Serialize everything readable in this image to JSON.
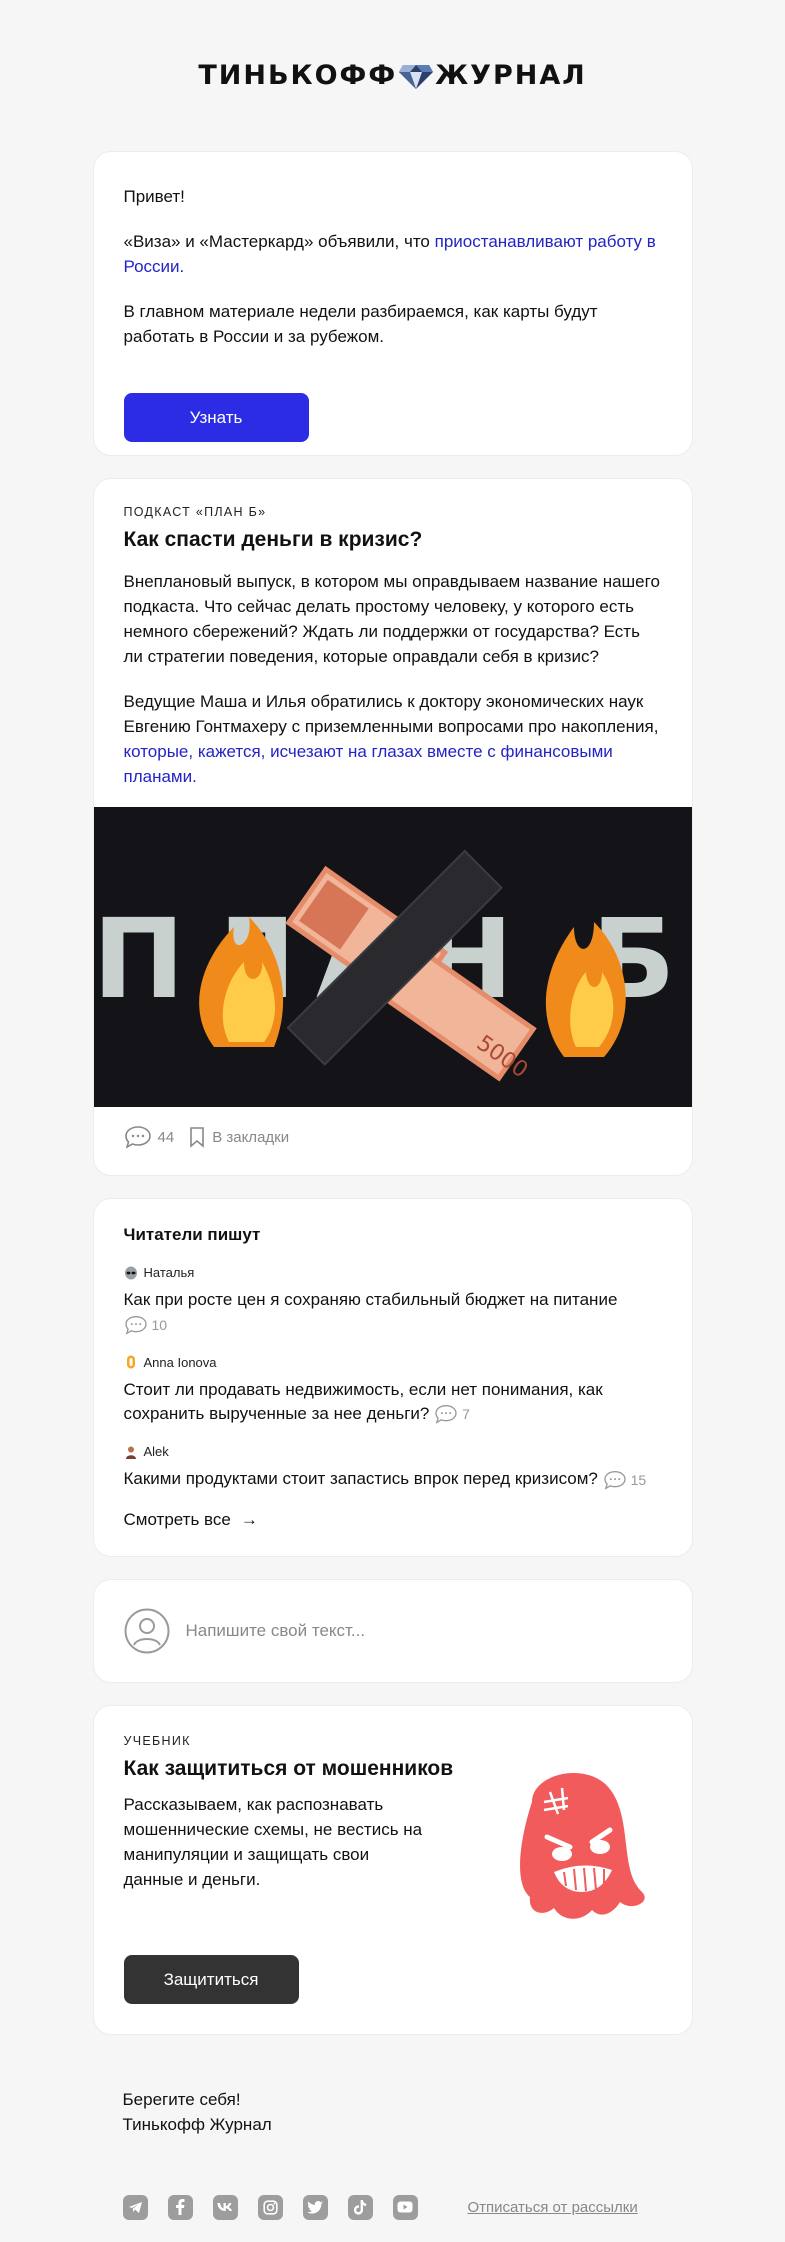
{
  "header": {
    "logo_left": "ТИНЬКОФФ",
    "logo_right": "ЖУРНАЛ"
  },
  "intro": {
    "greeting": "Привет!",
    "p1_text": "«Виза» и «Мастеркард» объявили, что ",
    "p1_link": "приостанавливают работу в России.",
    "p2": "В главном материале недели разбираемся, как карты будут работать в России и за рубежом.",
    "button": "Узнать"
  },
  "podcast": {
    "eyebrow": "ПОДКАСТ «ПЛАН Б»",
    "title": "Как спасти деньги в кризис?",
    "p1": "Внеплановый выпуск, в котором мы оправдываем название нашего подкаста. Что сейчас делать простому человеку, у которого есть немного сбережений? Ждать ли поддержки от государства? Есть ли стратегии поведения, которые оправдали себя в кризис?",
    "p2_text": "Ведущие Маша и Илья обратились к доктору экономических наук Евгению Гонтмахеру с приземленными вопросами про накопления, ",
    "p2_link": "которые, кажется, исчезают на глазах вместе с финансовыми планами.",
    "image_letters": "ПЛАН Б",
    "comments": "44",
    "bookmark": "В закладки"
  },
  "readers": {
    "title": "Читатели пишут",
    "items": [
      {
        "author": "Наталья",
        "text": "Как при росте цен я сохраняю стабильный бюджет на питание",
        "comments": "10"
      },
      {
        "author": "Anna Ionova",
        "text": "Стоит ли продавать недвижимость, если нет понимания, как сохранить вырученные за нее деньги?",
        "comments": "7"
      },
      {
        "author": "Alek",
        "text": "Какими продуктами стоит запастись впрок перед кризисом?",
        "comments": "15"
      }
    ],
    "see_all": "Смотреть все",
    "arrow": "→"
  },
  "write": {
    "placeholder": "Напишите свой текст..."
  },
  "tutorial": {
    "eyebrow": "УЧЕБНИК",
    "title": "Как защититься от мошенников",
    "desc": "Рассказываем, как распознавать мошеннические схемы, не вестись на манипуляции и защищать свои данные и деньги.",
    "button": "Защититься"
  },
  "footer": {
    "line1": "Берегите себя!",
    "line2": "Тинькофф Журнал",
    "unsubscribe": "Отписаться от рассылки"
  },
  "icons": [
    "telegram-icon",
    "facebook-icon",
    "vk-icon",
    "instagram-icon",
    "twitter-icon",
    "tiktok-icon",
    "youtube-icon"
  ],
  "colors": {
    "accent": "#2d2ce5",
    "link": "#2323c7",
    "dark_button": "#333333",
    "ghost": "#f25b5b"
  }
}
